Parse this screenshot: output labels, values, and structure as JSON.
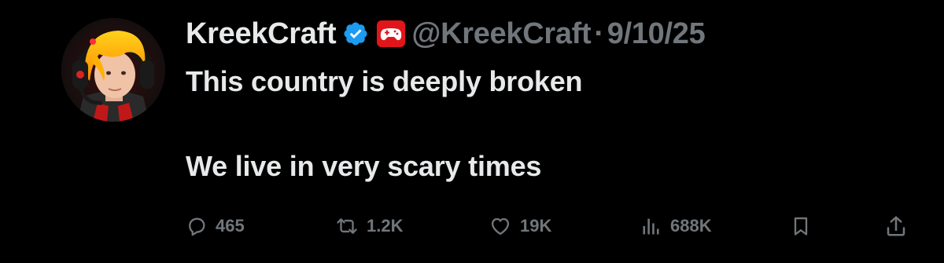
{
  "tweet": {
    "author": {
      "display_name": "KreekCraft",
      "handle": "@KreekCraft",
      "verified": true,
      "avatar_icon": "user-avatar-orange-hair-headset",
      "badge_icon": "gamepad-icon"
    },
    "separator": "·",
    "date": "9/10/25",
    "text_lines": [
      "This country is deeply broken",
      "We live in very scary times"
    ],
    "actions": {
      "reply": {
        "icon": "reply-icon",
        "count": "465"
      },
      "retweet": {
        "icon": "retweet-icon",
        "count": "1.2K"
      },
      "like": {
        "icon": "heart-icon",
        "count": "19K"
      },
      "views": {
        "icon": "views-icon",
        "count": "688K"
      },
      "bookmark": {
        "icon": "bookmark-icon"
      },
      "share": {
        "icon": "share-icon"
      }
    }
  },
  "colors": {
    "background": "#000000",
    "primary_text": "#e7e9ea",
    "secondary_text": "#71767b",
    "verified_blue": "#1d9bf0",
    "badge_red": "#e0161b"
  }
}
